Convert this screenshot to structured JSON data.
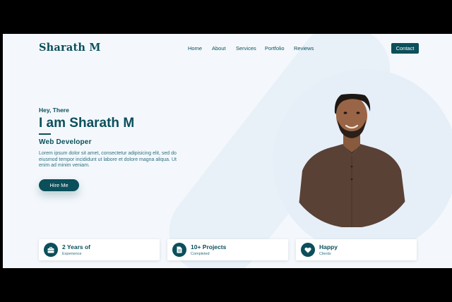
{
  "brand": {
    "logo": "Sharath M",
    "accent": "#0b4f5b"
  },
  "nav": {
    "items": [
      "Home",
      "About",
      "Services",
      "Portfolio",
      "Reviews"
    ],
    "contact": "Contact"
  },
  "hero": {
    "greeting": "Hey, There",
    "headline": "I am Sharath M",
    "role": "Web Developer",
    "description": "Lorem ipsum dolor sit amet, consectetur adipisicing elit, sed do eiusmod tempor incididunt ut labore et dolore magna aliqua. Ut enim ad minim veniam.",
    "cta": "Hire Me"
  },
  "stats": [
    {
      "title": "2 Years of",
      "subtitle": "Experience",
      "icon": "briefcase-icon"
    },
    {
      "title": "10+ Projects",
      "subtitle": "Completed",
      "icon": "document-icon"
    },
    {
      "title": "Happy",
      "subtitle": "Clients",
      "icon": "heart-icon"
    }
  ]
}
